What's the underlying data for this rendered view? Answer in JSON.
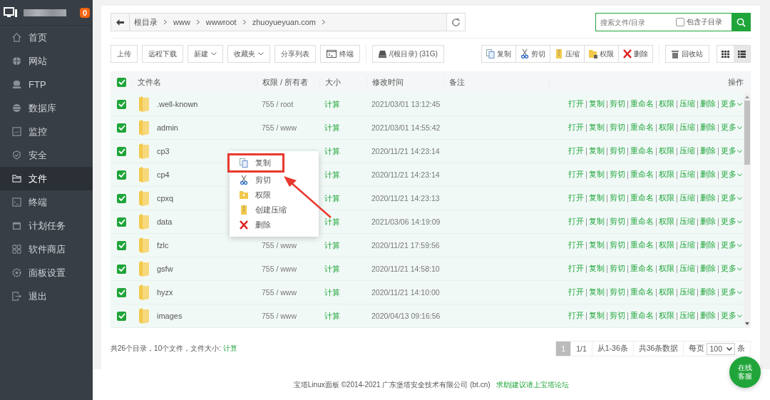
{
  "sidebar": {
    "badge": "0",
    "items": [
      {
        "label": "首页",
        "kind": "home",
        "selected": false
      },
      {
        "label": "网站",
        "kind": "globe",
        "selected": false
      },
      {
        "label": "FTP",
        "kind": "ftp",
        "selected": false
      },
      {
        "label": "数据库",
        "kind": "database",
        "selected": false
      },
      {
        "label": "监控",
        "kind": "monitor",
        "selected": false
      },
      {
        "label": "安全",
        "kind": "shield",
        "selected": false
      },
      {
        "label": "文件",
        "kind": "folder",
        "selected": true
      },
      {
        "label": "终端",
        "kind": "terminal",
        "selected": false
      },
      {
        "label": "计划任务",
        "kind": "calendar",
        "selected": false
      },
      {
        "label": "软件商店",
        "kind": "apps",
        "selected": false
      },
      {
        "label": "面板设置",
        "kind": "gear",
        "selected": false
      },
      {
        "label": "退出",
        "kind": "exit",
        "selected": false
      }
    ]
  },
  "breadcrumb": [
    "根目录",
    "www",
    "wwwroot",
    "zhuoyueyuan.com"
  ],
  "search": {
    "placeholder": "搜索文件/目录",
    "subdir_label": "包含子目录",
    "subdir_checked": false
  },
  "toolbar": [
    {
      "label": "上传",
      "kind": "plain"
    },
    {
      "label": "远程下载",
      "kind": "plain"
    },
    {
      "label": "新建",
      "kind": "dropdown"
    },
    {
      "label": "收藏夹",
      "kind": "dropdown"
    },
    {
      "label": "分享列表",
      "kind": "plain"
    },
    {
      "label": "终端",
      "kind": "terminal"
    },
    {
      "label": "/(根目录) (31G)",
      "kind": "disk"
    }
  ],
  "batch_actions": [
    {
      "label": "复制",
      "kind": "copy"
    },
    {
      "label": "剪切",
      "kind": "cut"
    },
    {
      "label": "压缩",
      "kind": "zip"
    },
    {
      "label": "权限",
      "kind": "perm"
    },
    {
      "label": "删除",
      "kind": "delete"
    }
  ],
  "recycle_label": "回收站",
  "views": [
    {
      "kind": "grid",
      "selected": false
    },
    {
      "kind": "list",
      "selected": true
    }
  ],
  "table": {
    "all_checked": true,
    "columns": [
      "文件名",
      "权限 / 所有者",
      "大小",
      "修改时间",
      "备注",
      "操作"
    ],
    "rows": [
      {
        "checked": true,
        "name": ".well-known",
        "perm": "755 / root",
        "size": "计算",
        "mtime": "2021/03/01 13:12:45",
        "actions": [
          "打开",
          "复制",
          "剪切",
          "重命名",
          "权限",
          "压缩",
          "删除",
          "更多"
        ]
      },
      {
        "checked": true,
        "name": "admin",
        "perm": "755 / www",
        "size": "计算",
        "mtime": "2021/03/01 14:55:42",
        "actions": [
          "打开",
          "复制",
          "剪切",
          "重命名",
          "权限",
          "压缩",
          "删除",
          "更多"
        ]
      },
      {
        "checked": true,
        "name": "cp3",
        "size": "计算",
        "mtime": "2020/11/21 14:23:14",
        "actions": [
          "打开",
          "复制",
          "剪切",
          "重命名",
          "权限",
          "压缩",
          "删除",
          "更多"
        ]
      },
      {
        "checked": true,
        "name": "cp4",
        "size": "计算",
        "mtime": "2020/11/21 14:23:14",
        "actions": [
          "打开",
          "复制",
          "剪切",
          "重命名",
          "权限",
          "压缩",
          "删除",
          "更多"
        ]
      },
      {
        "checked": true,
        "name": "cpxq",
        "size": "计算",
        "mtime": "2020/11/21 14:23:13",
        "actions": [
          "打开",
          "复制",
          "剪切",
          "重命名",
          "权限",
          "压缩",
          "删除",
          "更多"
        ]
      },
      {
        "checked": true,
        "name": "data",
        "size": "计算",
        "mtime": "2021/03/06 14:19:09",
        "actions": [
          "打开",
          "复制",
          "剪切",
          "重命名",
          "权限",
          "压缩",
          "删除",
          "更多"
        ]
      },
      {
        "checked": true,
        "name": "fzlc",
        "perm": "755 / www",
        "size": "计算",
        "mtime": "2020/11/21 17:59:56",
        "actions": [
          "打开",
          "复制",
          "剪切",
          "重命名",
          "权限",
          "压缩",
          "删除",
          "更多"
        ]
      },
      {
        "checked": true,
        "name": "gsfw",
        "perm": "755 / www",
        "size": "计算",
        "mtime": "2020/11/21 14:58:10",
        "actions": [
          "打开",
          "复制",
          "剪切",
          "重命名",
          "权限",
          "压缩",
          "删除",
          "更多"
        ]
      },
      {
        "checked": true,
        "name": "hyzx",
        "perm": "755 / www",
        "size": "计算",
        "mtime": "2020/11/21 14:10:00",
        "actions": [
          "打开",
          "复制",
          "剪切",
          "重命名",
          "权限",
          "压缩",
          "删除",
          "更多"
        ]
      },
      {
        "checked": true,
        "name": "images",
        "perm": "755 / www",
        "size": "计算",
        "mtime": "2020/04/13 09:16:56",
        "actions": [
          "打开",
          "复制",
          "剪切",
          "重命名",
          "权限",
          "压缩",
          "删除",
          "更多"
        ]
      }
    ]
  },
  "context_menu": [
    {
      "label": "复制",
      "kind": "copy",
      "highlighted": true
    },
    {
      "label": "剪切",
      "kind": "cut",
      "highlighted": false
    },
    {
      "label": "权限",
      "kind": "perm",
      "highlighted": false
    },
    {
      "label": "创建压缩",
      "kind": "zip",
      "highlighted": false
    },
    {
      "label": "删除",
      "kind": "delete",
      "highlighted": false
    }
  ],
  "summary": {
    "text": "共26个目录，10个文件，文件大小: ",
    "link": "计算"
  },
  "pagination": {
    "pages": [
      {
        "label": "1",
        "selected": true
      }
    ],
    "page_info": "1/1",
    "range": "从1-36条",
    "total": "共36条数据",
    "per_page_label": "每页",
    "per_page": "100",
    "unit": "条"
  },
  "footer": {
    "text": "宝塔Linux面板 ©2014-2021 广东堡塔安全技术有限公司 (bt.cn)",
    "link": "求助|建议请上宝塔论坛"
  },
  "chat_button": "在线客服"
}
